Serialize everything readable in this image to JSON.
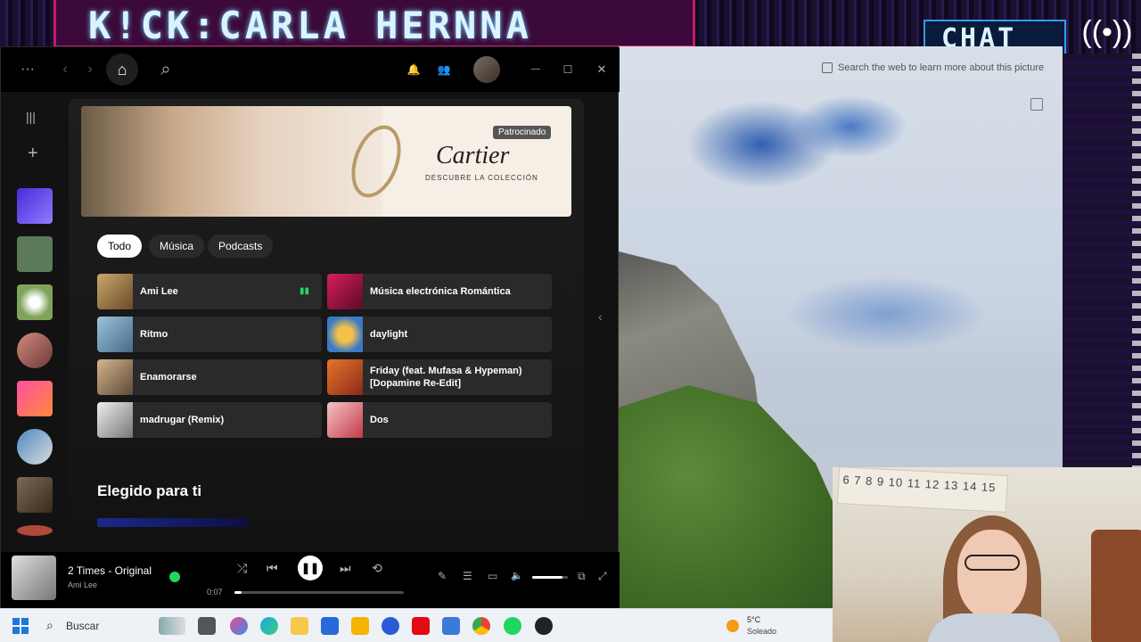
{
  "overlay": {
    "banner_text": "K!CK:CARLA HERNNA",
    "chat_text": "CHAT",
    "live_icon": "broadcast-icon"
  },
  "photo": {
    "hint": "Search the web to learn more about this picture"
  },
  "webcam": {
    "ruler_text": "6 7 8 9 10 11 12 13 14 15"
  },
  "spotify": {
    "titlebar": {
      "menu": "···",
      "back": "‹",
      "forward": "›",
      "home": "⌂",
      "search": "⌕",
      "bell": "🔔",
      "friends": "👥",
      "minimize": "—",
      "maximize": "☐",
      "close": "✕"
    },
    "sidebar": {
      "library": "|||",
      "add": "+"
    },
    "ad": {
      "brand": "Cartier",
      "tagline": "DESCUBRE LA COLECCIÓN",
      "badge": "Patrocinado"
    },
    "chips": [
      "Todo",
      "Música",
      "Podcasts"
    ],
    "tiles": [
      {
        "label": "Ami Lee",
        "playing": true
      },
      {
        "label": "Música electrónica Romántica",
        "playing": false
      },
      {
        "label": "Ritmo",
        "playing": false
      },
      {
        "label": "daylight",
        "playing": false
      },
      {
        "label": "Enamorarse",
        "playing": false
      },
      {
        "label": "Friday (feat. Mufasa & Hypeman) [Dopamine Re-Edit]",
        "playing": false
      },
      {
        "label": "madrugar (Remix)",
        "playing": false
      },
      {
        "label": "Dos",
        "playing": false
      }
    ],
    "section_title": "Elegido para ti",
    "collapse": "‹",
    "player": {
      "title": "2 Times - Original",
      "artist": "Ami Lee",
      "elapsed": "0:07",
      "progress": 0.04,
      "volume": 0.85,
      "shuffle": "⤮",
      "prev": "⏮",
      "play": "❚❚",
      "next": "⏭",
      "repeat": "⟲",
      "lyrics": "✎",
      "queue": "☰",
      "device": "▭",
      "vol_icon": "🔈",
      "mini": "⧉",
      "fullscreen": "⤢"
    }
  },
  "taskbar": {
    "search_label": "Buscar",
    "temperature": "5°C",
    "condition": "Soleado"
  },
  "colors": {
    "spotify_green": "#1ed760",
    "overlay_pink": "#c01a6a",
    "overlay_blue": "#2aa0ff"
  }
}
